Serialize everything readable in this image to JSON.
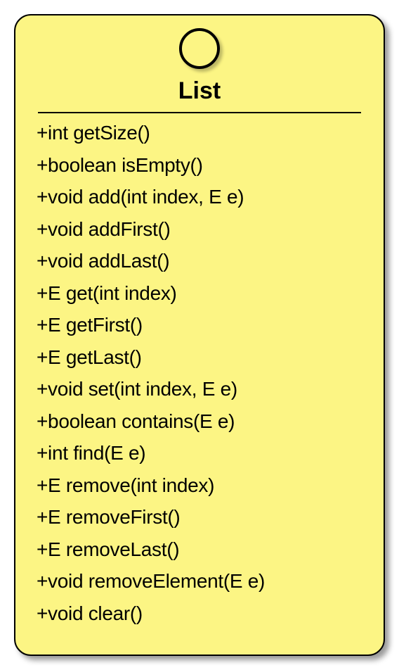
{
  "interface": {
    "name": "List",
    "stereotype": "interface",
    "methods": [
      "+int getSize()",
      "+boolean isEmpty()",
      "+void add(int index, E e)",
      "+void addFirst()",
      "+void addLast()",
      "+E get(int index)",
      "+E getFirst()",
      "+E getLast()",
      "+void set(int index, E e)",
      "+boolean contains(E e)",
      "+int find(E e)",
      "+E remove(int index)",
      "+E removeFirst()",
      "+E removeLast()",
      "+void removeElement(E e)",
      "+void clear()"
    ]
  },
  "colors": {
    "fill": "#fcf584",
    "border": "#000000"
  }
}
